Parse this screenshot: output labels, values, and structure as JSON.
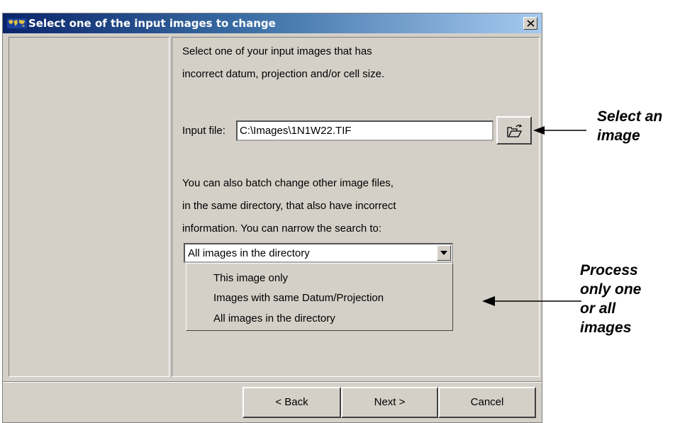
{
  "window": {
    "title": "Select one of the input images to change",
    "close_symbol": "×"
  },
  "instructions": {
    "line1": "Select one of your input images that has",
    "line2": "incorrect datum, projection and/or cell size."
  },
  "input_file": {
    "label": "Input file:",
    "value": "C:\\Images\\1N1W22.TIF"
  },
  "batch_text": {
    "line1": "You can also batch change other image files,",
    "line2": "in the same directory, that also have incorrect",
    "line3": "information.  You can narrow the search to:"
  },
  "scope_select": {
    "selected": "All images in the directory",
    "options": [
      "This image only",
      "Images with same Datum/Projection",
      "All images in the directory"
    ]
  },
  "buttons": {
    "back": "< Back",
    "next": "Next >",
    "cancel": "Cancel"
  },
  "annotations": {
    "select_image": [
      "Select an",
      "image"
    ],
    "process": [
      "Process",
      "only one",
      "or all",
      "images"
    ]
  },
  "icons": {
    "app": "world-map-icon",
    "browse": "open-folder-icon",
    "dropdown": "down-arrow-icon"
  }
}
